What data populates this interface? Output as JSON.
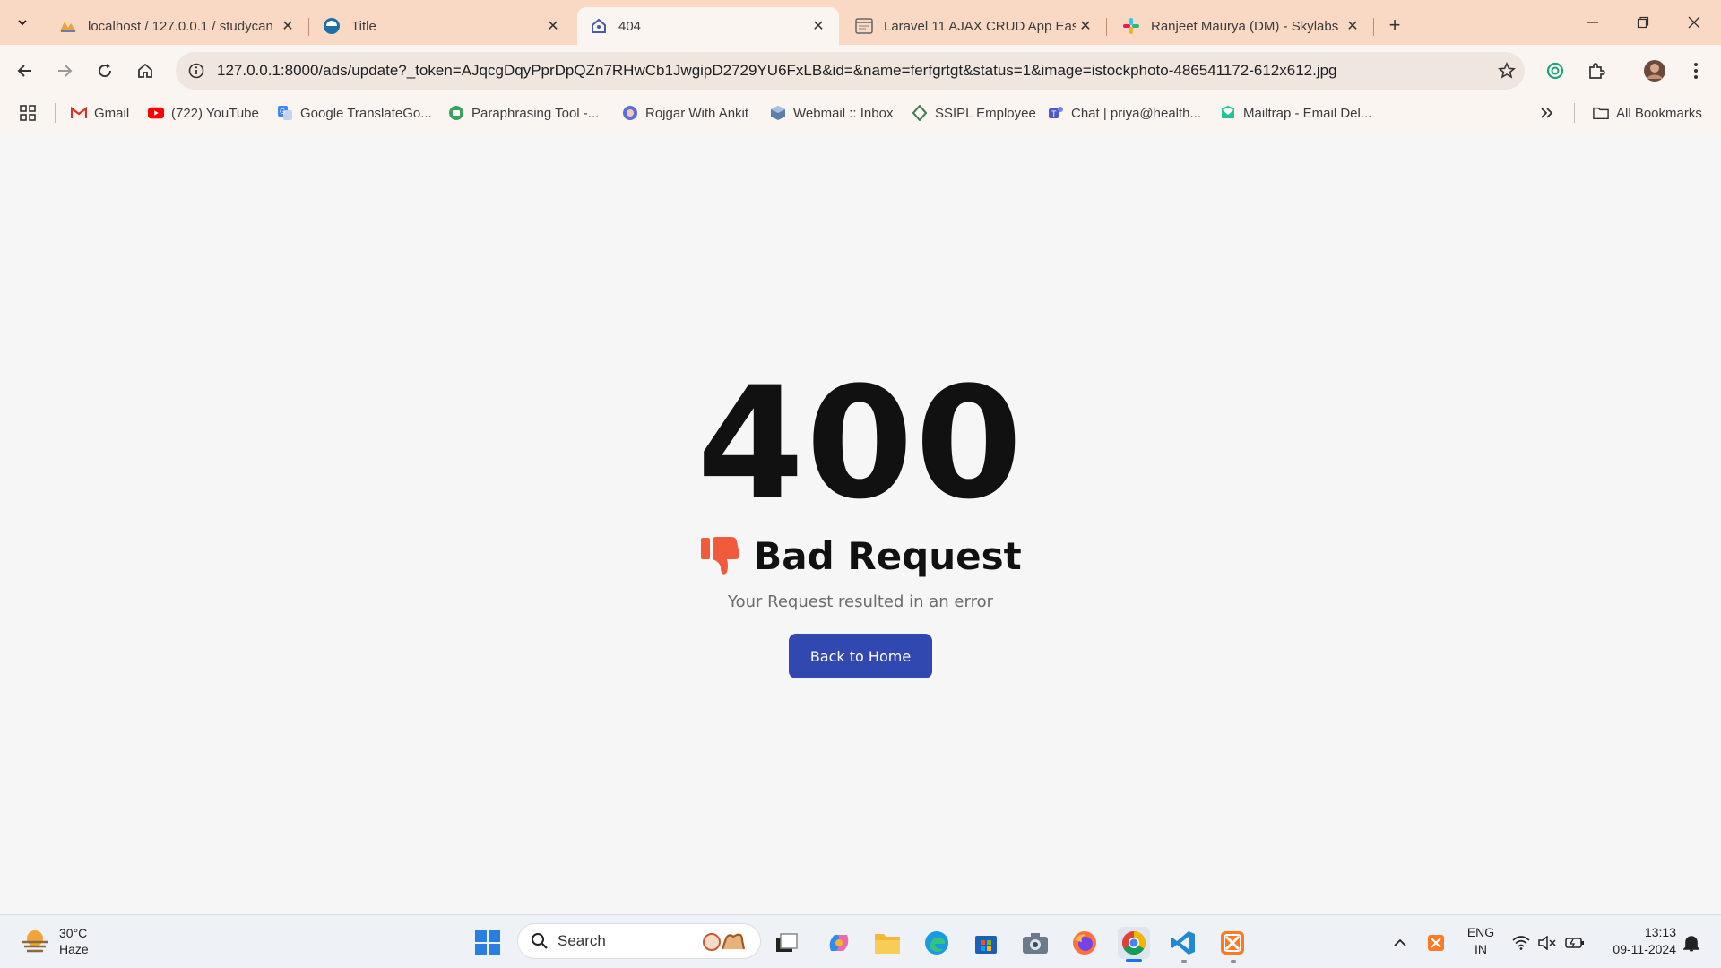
{
  "browser": {
    "tabs": [
      {
        "title": "localhost / 127.0.0.1 / studycan",
        "active": false
      },
      {
        "title": "Title",
        "active": false
      },
      {
        "title": "404",
        "active": true
      },
      {
        "title": "Laravel 11 AJAX CRUD App Easy",
        "active": false
      },
      {
        "title": "Ranjeet Maurya (DM) - Skylabs",
        "active": false
      }
    ],
    "url": "127.0.0.1:8000/ads/update?_token=AJqcgDqyPprDpQZn7RHwCb1JwgipD2729YU6FxLB&id=&name=ferfgrtgt&status=1&image=istockphoto-486541172-612x612.jpg",
    "bookmarks": [
      {
        "label": "Gmail"
      },
      {
        "label": "(722) YouTube"
      },
      {
        "label": "Google TranslateGo..."
      },
      {
        "label": "Paraphrasing Tool -..."
      },
      {
        "label": "Rojgar With Ankit"
      },
      {
        "label": "Webmail :: Inbox"
      },
      {
        "label": "SSIPL Employee"
      },
      {
        "label": "Chat | priya@health..."
      },
      {
        "label": "Mailtrap - Email Del..."
      }
    ],
    "all_bookmarks_label": "All Bookmarks"
  },
  "page": {
    "code": "400",
    "heading": "Bad Request",
    "message": "Your Request resulted in an error",
    "button_label": "Back to Home",
    "accent_color": "#3248b1",
    "thumb_color": "#f15a3a"
  },
  "taskbar": {
    "weather_temp": "30°C",
    "weather_desc": "Haze",
    "search_placeholder": "Search",
    "lang_line1": "ENG",
    "lang_line2": "IN",
    "time": "13:13",
    "date": "09-11-2024"
  }
}
